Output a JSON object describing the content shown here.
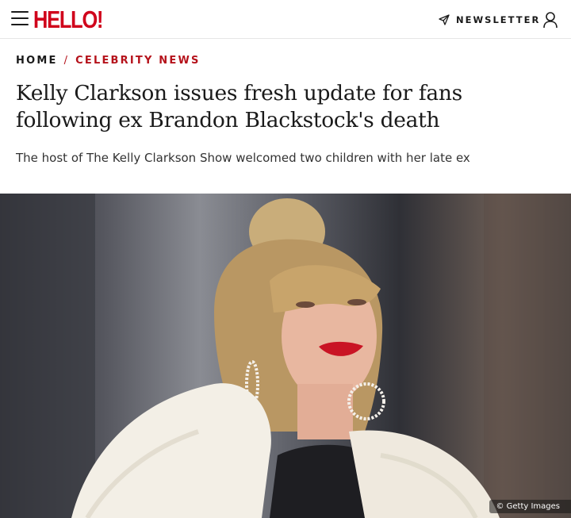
{
  "header": {
    "logo": "HELLO!",
    "newsletter_label": "NEWSLETTER",
    "icons": {
      "menu": "menu-icon",
      "newsletter": "send-icon",
      "account": "user-icon"
    },
    "brand_color": "#d0021b"
  },
  "breadcrumb": {
    "home": "HOME",
    "separator": "/",
    "category": "CELEBRITY NEWS"
  },
  "article": {
    "headline": "Kelly Clarkson issues fresh update for fans following ex Brandon Blackstock's death",
    "subheadline": "The host of The Kelly Clarkson Show welcomed two children with her late ex",
    "image_credit": "© Getty Images"
  }
}
